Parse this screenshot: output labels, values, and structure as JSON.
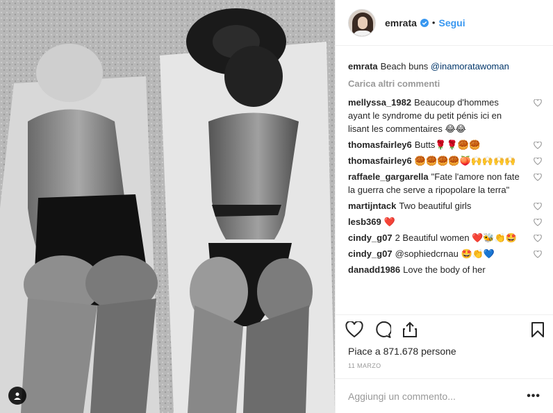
{
  "header": {
    "username": "emrata",
    "separator": "•",
    "follow_label": "Segui"
  },
  "caption": {
    "username": "emrata",
    "text": "Beach buns ",
    "mention": "@inamoratawoman"
  },
  "load_more_label": "Carica altri commenti",
  "comments": [
    {
      "user": "mellyssa_1982",
      "text": "Beaucoup d'hommes ayant le syndrome du petit pénis ici en lisant les commentaires 😂😂"
    },
    {
      "user": "thomasfairley6",
      "text": "Butts🌹🌹🥮🥮"
    },
    {
      "user": "thomasfairley6",
      "text": "🥮🥮🥮🥮🍑🙌🙌🙌🙌"
    },
    {
      "user": "raffaele_gargarella",
      "text": "\"Fate l'amore non fate la guerra che serve a ripopolare la terra\""
    },
    {
      "user": "martijntack",
      "text": "Two beautiful girls"
    },
    {
      "user": "lesb369",
      "text": "❤️"
    },
    {
      "user": "cindy_g07",
      "text": "2 Beautiful women ❤️🐝👏🤩"
    },
    {
      "user": "cindy_g07",
      "text": "@sophiedcrnau 🤩👏💙"
    },
    {
      "user": "danadd1986",
      "text": "Love the body of her"
    }
  ],
  "likes": {
    "text": "Piace a 871.678 persone"
  },
  "date": "11 MARZO",
  "add_comment": {
    "placeholder": "Aggiungi un commento...",
    "more_label": "•••"
  },
  "icons": {
    "verified": "verified-badge-icon",
    "heart": "heart-icon",
    "comment": "comment-bubble-icon",
    "share": "share-icon",
    "save": "bookmark-icon",
    "user_tag": "user-tag-icon"
  },
  "colors": {
    "accent": "#3897f0",
    "mention": "#003569",
    "muted": "#999999",
    "text": "#262626"
  }
}
